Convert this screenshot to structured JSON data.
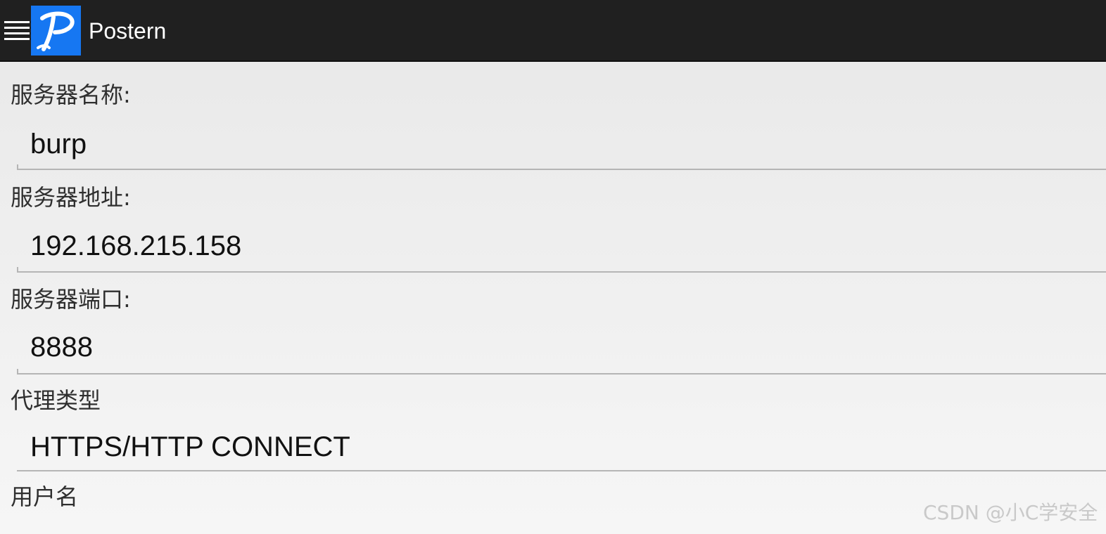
{
  "app": {
    "title": "Postern",
    "logo_text": "P",
    "menu_icon": "hamburger-menu-icon",
    "accent_color": "#1677f2",
    "bar_color": "#202020"
  },
  "form": {
    "server_name": {
      "label": "服务器名称:",
      "value": "burp"
    },
    "server_address": {
      "label": "服务器地址:",
      "value": "192.168.215.158"
    },
    "server_port": {
      "label": "服务器端口:",
      "value": "8888"
    },
    "proxy_type": {
      "label": "代理类型",
      "value": "HTTPS/HTTP CONNECT"
    },
    "username": {
      "label": "用户名"
    }
  },
  "watermark": "CSDN @小C学安全"
}
